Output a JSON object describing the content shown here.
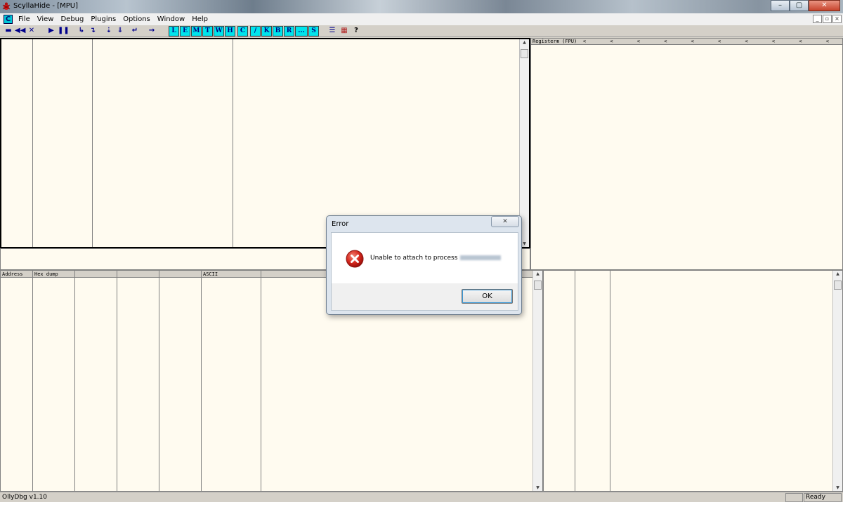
{
  "window": {
    "title": "ScyllaHide - [MPU]",
    "controls": {
      "minimize": "–",
      "maximize": "▢",
      "close": "✕"
    }
  },
  "menubar": {
    "mdi_icon_letter": "C",
    "items": [
      "File",
      "View",
      "Debug",
      "Plugins",
      "Options",
      "Window",
      "Help"
    ],
    "mdi_controls": [
      "_",
      "▫",
      "×"
    ]
  },
  "toolbar": {
    "std_buttons": [
      {
        "name": "open-icon",
        "glyph": "▬"
      },
      {
        "name": "restart-icon",
        "glyph": "◀◀"
      },
      {
        "name": "close-process-icon",
        "glyph": "✕"
      },
      {
        "name": "run-icon",
        "glyph": "▶"
      },
      {
        "name": "pause-icon",
        "glyph": "❚❚"
      },
      {
        "name": "step-into-icon",
        "glyph": "↳"
      },
      {
        "name": "step-over-icon",
        "glyph": "↴"
      },
      {
        "name": "trace-into-icon",
        "glyph": "⇣"
      },
      {
        "name": "trace-over-icon",
        "glyph": "⇓"
      },
      {
        "name": "execute-till-return-icon",
        "glyph": "↵"
      },
      {
        "name": "goto-icon",
        "glyph": "→"
      }
    ],
    "letter_buttons": [
      "L",
      "E",
      "M",
      "T",
      "W",
      "H",
      "C",
      "/",
      "K",
      "B",
      "R",
      "...",
      "S"
    ],
    "extra_buttons": [
      {
        "name": "list-icon",
        "glyph": "☰"
      },
      {
        "name": "colors-icon",
        "glyph": "▦"
      },
      {
        "name": "help-icon",
        "glyph": "?"
      }
    ]
  },
  "registers_pane": {
    "header": "Registers (FPU)",
    "arrows": "< < < < < < < < < < <"
  },
  "dump_pane": {
    "headers": [
      "Address",
      "Hex dump",
      "ASCII"
    ]
  },
  "status": {
    "left": "OllyDbg v1.10",
    "right": "Ready"
  },
  "dialog": {
    "title": "Error",
    "close_glyph": "✕",
    "message": "Unable to attach to process",
    "ok_label": "OK"
  }
}
